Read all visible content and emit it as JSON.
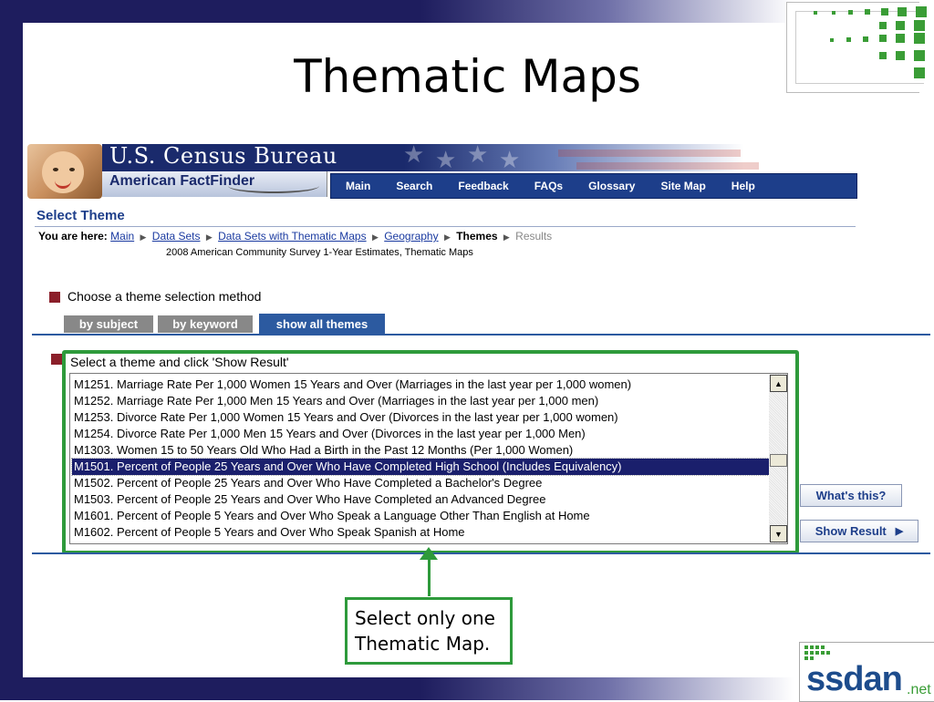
{
  "slide": {
    "title": "Thematic Maps"
  },
  "census": {
    "bureau_title": "U.S. Census Bureau",
    "factfinder_label": "American FactFinder",
    "nav": [
      "Main",
      "Search",
      "Feedback",
      "FAQs",
      "Glossary",
      "Site Map",
      "Help"
    ]
  },
  "page": {
    "heading": "Select Theme",
    "breadcrumb_prefix": "You are here:",
    "breadcrumb": [
      "Main",
      "Data Sets",
      "Data Sets with Thematic Maps",
      "Geography"
    ],
    "breadcrumb_current": "Themes",
    "breadcrumb_next": "Results",
    "dataset_subtitle": "2008 American Community Survey 1-Year Estimates, Thematic Maps",
    "choose_label": "Choose a theme selection method",
    "tabs": [
      {
        "label": "by subject",
        "active": false
      },
      {
        "label": "by keyword",
        "active": false
      },
      {
        "label": "show all themes",
        "active": true
      }
    ],
    "list_label": "Select a theme and click 'Show Result'",
    "themes": [
      "M1251. Marriage Rate Per 1,000 Women 15 Years and Over (Marriages in the last year per 1,000 women)",
      "M1252. Marriage Rate Per 1,000 Men 15 Years and Over (Marriages in the last year per 1,000 men)",
      "M1253. Divorce Rate Per 1,000 Women 15 Years and Over (Divorces in the last year per 1,000 women)",
      "M1254. Divorce Rate Per 1,000 Men 15 Years and Over (Divorces in the last year per 1,000 Men)",
      "M1303. Women 15 to 50 Years Old Who Had a Birth in the Past 12 Months (Per 1,000 Women)",
      "M1501. Percent of People 25 Years and Over Who Have Completed High School (Includes Equivalency)",
      "M1502. Percent of People 25 Years and Over Who Have Completed a Bachelor's Degree",
      "M1503. Percent of People 25 Years and Over Who Have Completed an Advanced Degree",
      "M1601. Percent of People 5 Years and Over Who Speak a Language Other Than English at Home",
      "M1602. Percent of People 5 Years and Over Who Speak Spanish at Home"
    ],
    "selected_index": 5,
    "whats_this_button": "What's this?",
    "show_result_button": "Show Result"
  },
  "callout": {
    "line1": "Select only one",
    "line2": "Thematic Map."
  },
  "brand": {
    "ssdan": "ssdan",
    "net": ".net"
  },
  "colors": {
    "frame": "#1e1d5e",
    "accent_green": "#2e9a3b",
    "nav_blue": "#1d3e8a",
    "selected_row": "#1a1f6c",
    "bullet": "#8b1f2a"
  }
}
